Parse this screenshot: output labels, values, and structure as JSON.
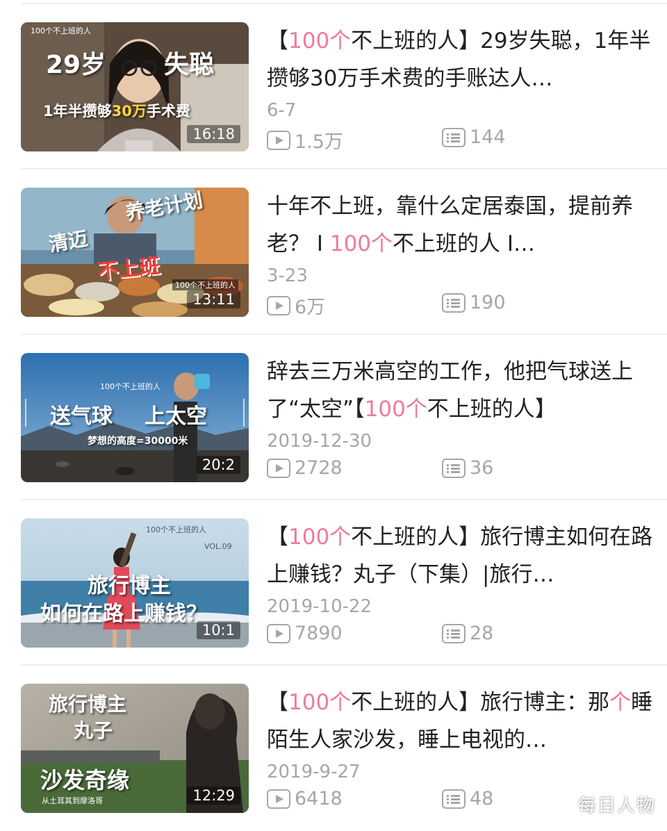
{
  "brand_color": "#f07a9c",
  "muted_color": "#a6a6a6",
  "icons": {
    "play": "play-count-icon",
    "danmaku": "danmaku-count-icon"
  },
  "videos": [
    {
      "title_parts": [
        "【",
        "100个",
        "不上班的人】29岁失聪，1年半攒够30万手术费的手账达人…"
      ],
      "title_highlight_index": 1,
      "date": "6-7",
      "plays": "1.5万",
      "danmaku": "144",
      "duration": "16:18",
      "thumb_caption_lines": [
        "29岁",
        "失聪",
        "1年半攒够",
        "30万",
        "手术费"
      ],
      "thumb_small_text": "100个不上班的人"
    },
    {
      "title_parts": [
        "十年不上班，靠什么定居泰国，提前养老？ I ",
        "100个",
        "不上班的人 I…"
      ],
      "title_highlight_index": 1,
      "date": "3-23",
      "plays": "6万",
      "danmaku": "190",
      "duration": "13:11",
      "thumb_caption_lines": [
        "清迈",
        "养老计划",
        "不上班"
      ],
      "thumb_small_text": "100个不上班的人"
    },
    {
      "title_parts": [
        "辞去三万米高空的工作，他把气球送上了“太空”【",
        "100个",
        "不上班的人】"
      ],
      "title_highlight_index": 1,
      "date": "2019-12-30",
      "plays": "2728",
      "danmaku": "36",
      "duration": "20:2",
      "thumb_caption_lines": [
        "送气球",
        "上太空",
        "梦想的高度=30000米"
      ],
      "thumb_small_text": "100个不上班的人"
    },
    {
      "title_parts": [
        "【",
        "100个",
        "不上班的人】旅行博主如何在路上赚钱？丸子（下集）|旅行…"
      ],
      "title_highlight_index": 1,
      "date": "2019-10-22",
      "plays": "7890",
      "danmaku": "28",
      "duration": "10:1",
      "thumb_caption_lines": [
        "旅行博主",
        "如何在路上赚钱？",
        "VOL.09"
      ],
      "thumb_small_text": "100个不上班的人"
    },
    {
      "title_parts": [
        "【",
        "100个",
        "不上班的人】旅行博主：那",
        "个",
        "睡陌生人家沙发，睡上电视的…"
      ],
      "title_highlight_index": [
        1,
        3
      ],
      "date": "2019-9-27",
      "plays": "6418",
      "danmaku": "48",
      "duration": "12:29",
      "thumb_caption_lines": [
        "旅行博主",
        "丸子",
        "沙发奇缘",
        "从土耳其到摩洛哥"
      ],
      "thumb_small_text": ""
    }
  ],
  "watermark": "每日人物"
}
